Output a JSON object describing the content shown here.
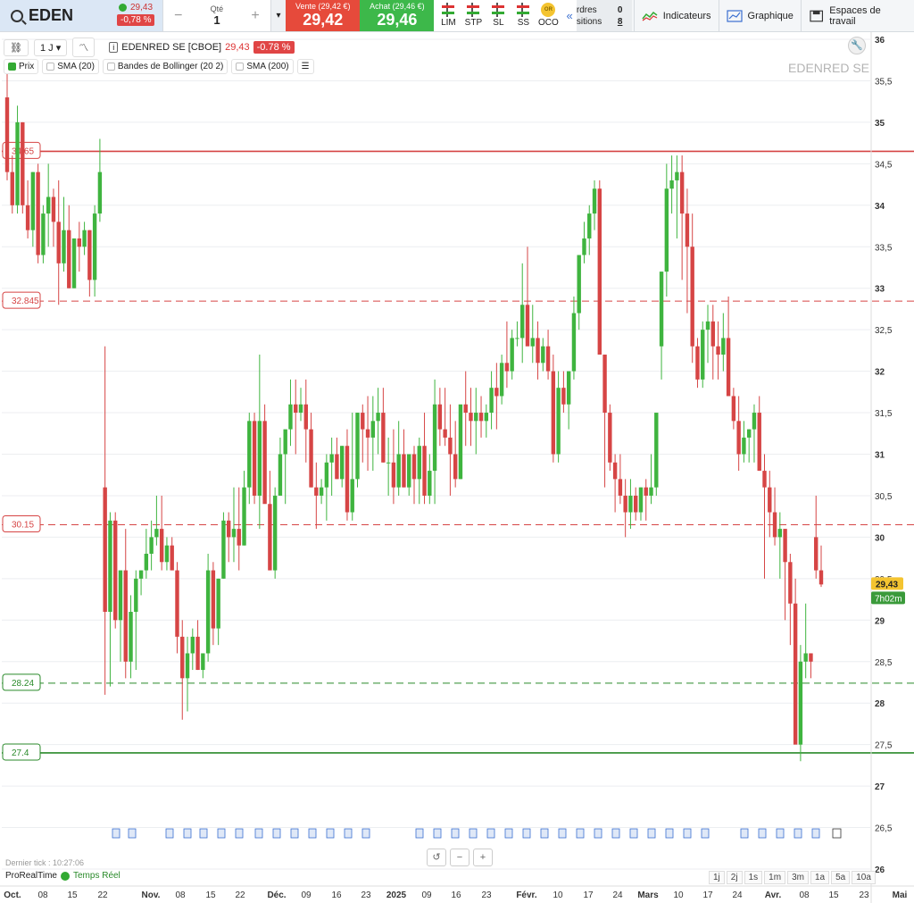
{
  "top": {
    "ticker": "EDEN",
    "price": "29,43",
    "change": "-0,78 %",
    "qty_label": "Qté",
    "qty_value": "1",
    "sell_label": "Vente (29,42 €)",
    "sell_value": "29,42",
    "buy_label": "Achat (29,46 €)",
    "buy_value": "29,46",
    "order_types": [
      "LIM",
      "STP",
      "SL",
      "SS",
      "OCO"
    ],
    "oco_badge": "OR",
    "orders_label": "rdres",
    "orders_count": "0",
    "positions_label": "sitions",
    "positions_count": "8",
    "indicators_label": "Indicateurs",
    "chart_label": "Graphique",
    "workspace_label": "Espaces de travail"
  },
  "toolbar": {
    "timeframe": "1 J",
    "instrument": "EDENRED SE [CBOE]",
    "price": "29,43",
    "change": "-0.78 %"
  },
  "legend": [
    "Prix",
    "SMA (20)",
    "Bandes de Bollinger (20 2)",
    "SMA (200)"
  ],
  "watermark": "EDENRED SE",
  "footer": {
    "last_tick": "Dernier tick : 10:27:06",
    "brand": "ProRealTime",
    "realtime": "Temps Réel",
    "periods": [
      "1j",
      "2j",
      "1s",
      "1m",
      "3m",
      "1a",
      "5a",
      "10a"
    ]
  },
  "colors": {
    "up": "#3fb43f",
    "down": "#d64545",
    "sell": "#e64a3b",
    "buy": "#3db84a"
  },
  "chart_data": {
    "type": "candlestick",
    "yaxis_ticks": [
      "36",
      "35,5",
      "35",
      "34,5",
      "34",
      "33,5",
      "33",
      "32,5",
      "32",
      "31,5",
      "31",
      "30,5",
      "30",
      "29,5",
      "29",
      "28,5",
      "28",
      "27,5",
      "27",
      "26,5",
      "26"
    ],
    "ylim": [
      26,
      36
    ],
    "xaxis_ticks": [
      "Oct.",
      "08",
      "15",
      "22",
      "Nov.",
      "08",
      "15",
      "22",
      "Déc.",
      "09",
      "16",
      "23",
      "2025",
      "09",
      "16",
      "23",
      "Févr.",
      "10",
      "17",
      "24",
      "Mars",
      "10",
      "17",
      "24",
      "Avr.",
      "08",
      "15",
      "23",
      "Mai"
    ],
    "levels": [
      {
        "label": "34.65",
        "value": 34.65,
        "style": "solid",
        "color": "#d64545"
      },
      {
        "label": "32.845",
        "value": 32.845,
        "style": "dashed",
        "color": "#d64545"
      },
      {
        "label": "30.15",
        "value": 30.15,
        "style": "dashed",
        "color": "#d64545"
      },
      {
        "label": "28.24",
        "value": 28.24,
        "style": "dashed",
        "color": "#2a8a2a"
      },
      {
        "label": "27.4",
        "value": 27.4,
        "style": "solid",
        "color": "#2a8a2a"
      }
    ],
    "last_price_label": "29,43",
    "countdown_label": "7h02m",
    "candles": [
      [
        35.3,
        35.6,
        34.3,
        34.4
      ],
      [
        34.4,
        34.6,
        33.9,
        34.0
      ],
      [
        34.0,
        35.2,
        33.9,
        35.0
      ],
      [
        35.0,
        35.0,
        33.9,
        34.0
      ],
      [
        34.0,
        34.3,
        33.6,
        33.7
      ],
      [
        33.7,
        34.4,
        33.5,
        34.4
      ],
      [
        34.4,
        34.5,
        33.3,
        33.4
      ],
      [
        33.4,
        34.0,
        33.3,
        33.9
      ],
      [
        33.9,
        34.5,
        33.5,
        34.1
      ],
      [
        34.1,
        34.2,
        33.5,
        33.8
      ],
      [
        33.8,
        34.3,
        32.8,
        33.3
      ],
      [
        33.3,
        34.1,
        33.2,
        33.7
      ],
      [
        33.7,
        34.0,
        33.0,
        33.0
      ],
      [
        33.0,
        33.6,
        33.0,
        33.6
      ],
      [
        33.6,
        33.8,
        33.2,
        33.5
      ],
      [
        33.5,
        33.8,
        33.4,
        33.7
      ],
      [
        33.7,
        33.7,
        32.9,
        33.1
      ],
      [
        33.1,
        34.0,
        32.9,
        33.9
      ],
      [
        33.9,
        34.8,
        33.8,
        34.4
      ],
      [
        30.6,
        32.3,
        28.1,
        29.1
      ],
      [
        29.1,
        30.3,
        28.2,
        30.2
      ],
      [
        30.2,
        30.3,
        28.9,
        29.0
      ],
      [
        29.0,
        29.6,
        28.5,
        29.6
      ],
      [
        29.6,
        30.1,
        28.3,
        28.5
      ],
      [
        28.5,
        29.3,
        28.3,
        29.1
      ],
      [
        29.1,
        29.6,
        28.4,
        29.5
      ],
      [
        29.5,
        29.6,
        29.3,
        29.6
      ],
      [
        29.6,
        30.1,
        29.5,
        29.8
      ],
      [
        29.8,
        30.2,
        29.6,
        30.0
      ],
      [
        30.0,
        30.5,
        29.9,
        30.1
      ],
      [
        30.1,
        30.5,
        29.6,
        29.7
      ],
      [
        29.7,
        30.0,
        29.6,
        29.9
      ],
      [
        29.9,
        30.0,
        29.6,
        29.6
      ],
      [
        29.6,
        29.7,
        28.6,
        28.8
      ],
      [
        28.8,
        29.0,
        27.8,
        28.3
      ],
      [
        28.3,
        28.8,
        27.9,
        28.6
      ],
      [
        28.6,
        28.9,
        28.4,
        28.8
      ],
      [
        28.8,
        29.0,
        28.4,
        28.4
      ],
      [
        28.4,
        28.6,
        28.3,
        28.6
      ],
      [
        28.6,
        29.8,
        28.5,
        29.6
      ],
      [
        29.6,
        29.7,
        28.7,
        28.9
      ],
      [
        28.9,
        29.5,
        28.7,
        29.5
      ],
      [
        29.5,
        30.3,
        29.5,
        30.2
      ],
      [
        30.2,
        30.3,
        29.7,
        30.0
      ],
      [
        30.0,
        30.6,
        29.7,
        30.1
      ],
      [
        30.1,
        30.6,
        29.6,
        29.9
      ],
      [
        29.9,
        30.8,
        29.9,
        30.6
      ],
      [
        30.6,
        31.5,
        30.4,
        31.4
      ],
      [
        31.4,
        31.5,
        30.4,
        30.5
      ],
      [
        30.5,
        32.2,
        30.1,
        31.4
      ],
      [
        31.4,
        31.6,
        30.6,
        30.4
      ],
      [
        30.4,
        30.8,
        29.6,
        29.6
      ],
      [
        29.6,
        30.6,
        29.5,
        30.5
      ],
      [
        30.5,
        31.2,
        30.5,
        31.0
      ],
      [
        31.0,
        31.2,
        30.4,
        31.3
      ],
      [
        31.3,
        31.9,
        31.1,
        31.6
      ],
      [
        31.6,
        31.9,
        31.0,
        31.5
      ],
      [
        31.5,
        31.8,
        31.4,
        31.6
      ],
      [
        31.6,
        31.9,
        30.9,
        31.3
      ],
      [
        31.3,
        31.5,
        30.6,
        30.6
      ],
      [
        30.6,
        30.9,
        30.1,
        30.5
      ],
      [
        30.5,
        30.7,
        30.4,
        30.6
      ],
      [
        30.6,
        31.0,
        30.2,
        30.9
      ],
      [
        30.9,
        31.2,
        30.5,
        31.0
      ],
      [
        31.0,
        31.2,
        30.7,
        30.7
      ],
      [
        30.7,
        31.1,
        30.6,
        31.1
      ],
      [
        31.1,
        31.3,
        30.2,
        30.3
      ],
      [
        30.3,
        31.5,
        30.2,
        30.7
      ],
      [
        30.7,
        31.5,
        30.6,
        31.5
      ],
      [
        31.5,
        31.6,
        30.9,
        31.3
      ],
      [
        31.3,
        31.7,
        30.8,
        31.2
      ],
      [
        31.2,
        31.7,
        30.8,
        31.4
      ],
      [
        31.4,
        31.8,
        31.0,
        31.5
      ],
      [
        31.5,
        31.8,
        30.9,
        30.9
      ],
      [
        30.9,
        31.2,
        30.5,
        30.9
      ],
      [
        30.9,
        31.3,
        30.4,
        30.6
      ],
      [
        30.6,
        31.4,
        30.5,
        31.0
      ],
      [
        31.0,
        31.3,
        30.6,
        30.6
      ],
      [
        30.6,
        31.0,
        30.5,
        31.0
      ],
      [
        31.0,
        31.1,
        30.4,
        30.7
      ],
      [
        30.7,
        31.2,
        30.4,
        31.1
      ],
      [
        31.1,
        31.5,
        30.4,
        30.5
      ],
      [
        30.5,
        31.0,
        30.4,
        30.8
      ],
      [
        30.8,
        31.9,
        30.4,
        31.6
      ],
      [
        31.6,
        31.8,
        31.1,
        31.3
      ],
      [
        31.3,
        31.8,
        31.1,
        31.2
      ],
      [
        31.2,
        31.6,
        30.5,
        31.0
      ],
      [
        31.0,
        31.4,
        30.6,
        30.7
      ],
      [
        30.7,
        31.5,
        30.7,
        31.6
      ],
      [
        31.6,
        32.0,
        31.1,
        31.5
      ],
      [
        31.5,
        31.8,
        31.1,
        31.4
      ],
      [
        31.4,
        31.8,
        31.0,
        31.5
      ],
      [
        31.5,
        31.7,
        31.2,
        31.4
      ],
      [
        31.4,
        31.6,
        31.2,
        31.5
      ],
      [
        31.5,
        32.0,
        31.3,
        31.8
      ],
      [
        31.8,
        32.1,
        31.3,
        31.7
      ],
      [
        31.7,
        32.2,
        31.6,
        32.1
      ],
      [
        32.1,
        32.6,
        31.8,
        32.0
      ],
      [
        32.0,
        32.5,
        31.9,
        32.4
      ],
      [
        32.4,
        32.6,
        32.3,
        32.4
      ],
      [
        32.4,
        33.3,
        32.1,
        32.8
      ],
      [
        32.8,
        33.5,
        32.5,
        32.3
      ],
      [
        32.3,
        32.8,
        32.1,
        32.4
      ],
      [
        32.4,
        32.6,
        31.9,
        32.1
      ],
      [
        32.1,
        32.4,
        32.0,
        32.3
      ],
      [
        32.3,
        32.5,
        31.9,
        32.0
      ],
      [
        32.0,
        32.2,
        30.9,
        31.0
      ],
      [
        31.0,
        32.0,
        30.9,
        31.8
      ],
      [
        31.8,
        32.0,
        31.5,
        31.6
      ],
      [
        31.6,
        32.0,
        31.3,
        32.0
      ],
      [
        32.0,
        32.9,
        31.9,
        32.7
      ],
      [
        32.7,
        33.2,
        32.5,
        33.4
      ],
      [
        33.4,
        33.8,
        33.3,
        33.6
      ],
      [
        33.6,
        34.0,
        33.4,
        33.9
      ],
      [
        33.9,
        34.3,
        33.7,
        34.2
      ],
      [
        34.2,
        34.3,
        32.2,
        32.2
      ],
      [
        32.2,
        32.2,
        30.6,
        31.5
      ],
      [
        31.5,
        31.6,
        30.8,
        30.9
      ],
      [
        30.9,
        31.0,
        30.3,
        30.7
      ],
      [
        30.7,
        31.0,
        30.4,
        30.5
      ],
      [
        30.5,
        30.7,
        30.0,
        30.3
      ],
      [
        30.3,
        30.7,
        30.1,
        30.5
      ],
      [
        30.5,
        30.6,
        30.2,
        30.3
      ],
      [
        30.3,
        30.6,
        30.2,
        30.6
      ],
      [
        30.6,
        30.7,
        30.2,
        30.5
      ],
      [
        30.5,
        31.0,
        30.4,
        30.6
      ],
      [
        30.6,
        31.2,
        30.5,
        31.5
      ],
      [
        32.3,
        33.2,
        31.9,
        33.2
      ],
      [
        33.2,
        34.5,
        32.9,
        34.2
      ],
      [
        34.2,
        34.6,
        33.9,
        34.3
      ],
      [
        34.3,
        34.6,
        33.6,
        34.4
      ],
      [
        34.4,
        34.6,
        33.1,
        33.9
      ],
      [
        33.9,
        34.2,
        32.7,
        33.5
      ],
      [
        33.5,
        33.9,
        32.1,
        32.3
      ],
      [
        32.3,
        32.4,
        31.8,
        31.9
      ],
      [
        31.9,
        32.6,
        31.8,
        32.5
      ],
      [
        32.5,
        32.8,
        32.1,
        32.6
      ],
      [
        32.6,
        32.8,
        31.9,
        32.3
      ],
      [
        32.3,
        32.6,
        31.9,
        32.2
      ],
      [
        32.2,
        32.7,
        32.0,
        32.4
      ],
      [
        32.4,
        32.9,
        31.7,
        31.7
      ],
      [
        31.7,
        31.8,
        31.3,
        31.4
      ],
      [
        31.4,
        31.7,
        30.8,
        31.0
      ],
      [
        31.0,
        31.4,
        30.9,
        31.2
      ],
      [
        31.2,
        31.3,
        30.9,
        31.3
      ],
      [
        31.3,
        31.6,
        30.9,
        31.5
      ],
      [
        31.5,
        31.7,
        30.8,
        30.8
      ],
      [
        30.8,
        31.0,
        29.5,
        30.6
      ],
      [
        30.6,
        30.8,
        30.0,
        30.3
      ],
      [
        30.3,
        30.6,
        29.9,
        30.0
      ],
      [
        30.0,
        30.3,
        29.5,
        30.1
      ],
      [
        30.1,
        30.1,
        29.0,
        29.7
      ],
      [
        29.7,
        29.8,
        28.7,
        29.2
      ],
      [
        29.2,
        29.5,
        28.3,
        27.5
      ],
      [
        27.5,
        28.7,
        27.3,
        28.5
      ],
      [
        28.5,
        29.2,
        28.3,
        28.6
      ],
      [
        28.6,
        28.6,
        28.3,
        28.5
      ],
      [
        30.0,
        30.5,
        29.5,
        29.6
      ],
      [
        29.6,
        29.9,
        29.4,
        29.43
      ]
    ]
  }
}
